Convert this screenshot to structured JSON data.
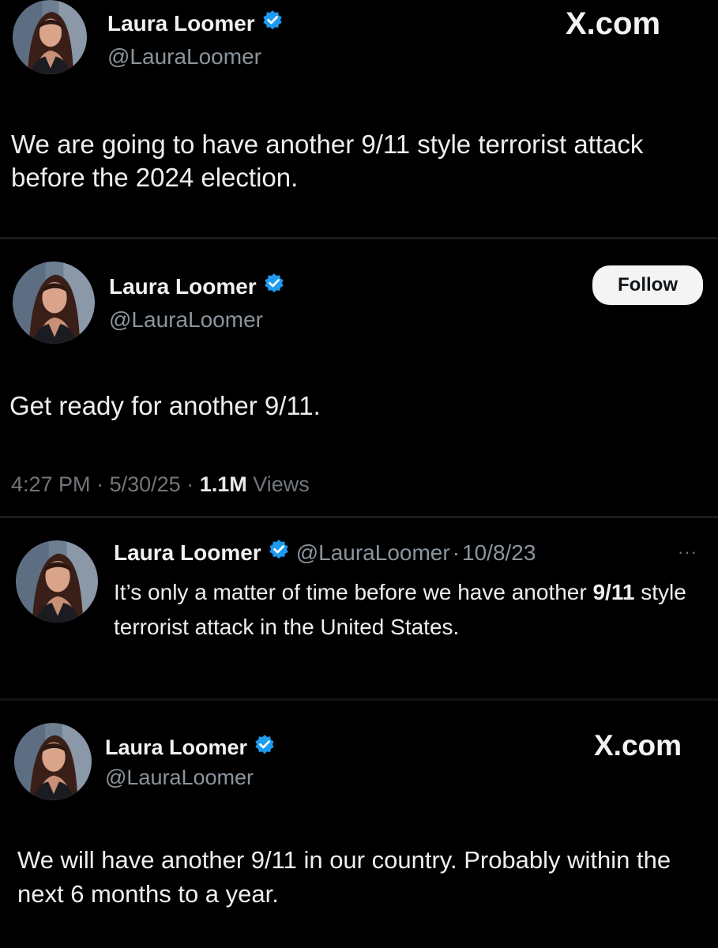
{
  "tweet1": {
    "name": "Laura Loomer",
    "handle": "@LauraLoomer",
    "brand": "X.com",
    "text": "We are going to have another 9/11 style terrorist attack before the 2024 election.",
    "icons": [
      "verified-badge-icon",
      "avatar"
    ]
  },
  "tweet2": {
    "name": "Laura Loomer",
    "handle": "@LauraLoomer",
    "follow_label": "Follow",
    "text": "Get ready for another 9/11.",
    "time": "4:27 PM",
    "date": "5/30/25",
    "views_count": "1.1M",
    "views_label": "Views",
    "separator": "·"
  },
  "tweet3": {
    "name": "Laura Loomer",
    "handle": "@LauraLoomer",
    "date": "10/8/23",
    "separator": "·",
    "more": "···",
    "text_before": "It’s only a matter of time before we have another ",
    "text_bold": "9/11",
    "text_after": " style terrorist attack in the United States."
  },
  "tweet4": {
    "name": "Laura Loomer",
    "handle": "@LauraLoomer",
    "brand": "X.com",
    "text": "We will have another 9/11 in our country. Probably within the next 6 months to a year."
  },
  "colors": {
    "background": "#000000",
    "verified_blue": "#1d9bf0",
    "handle_gray": "#8b949c",
    "text": "#e7e9ea"
  }
}
